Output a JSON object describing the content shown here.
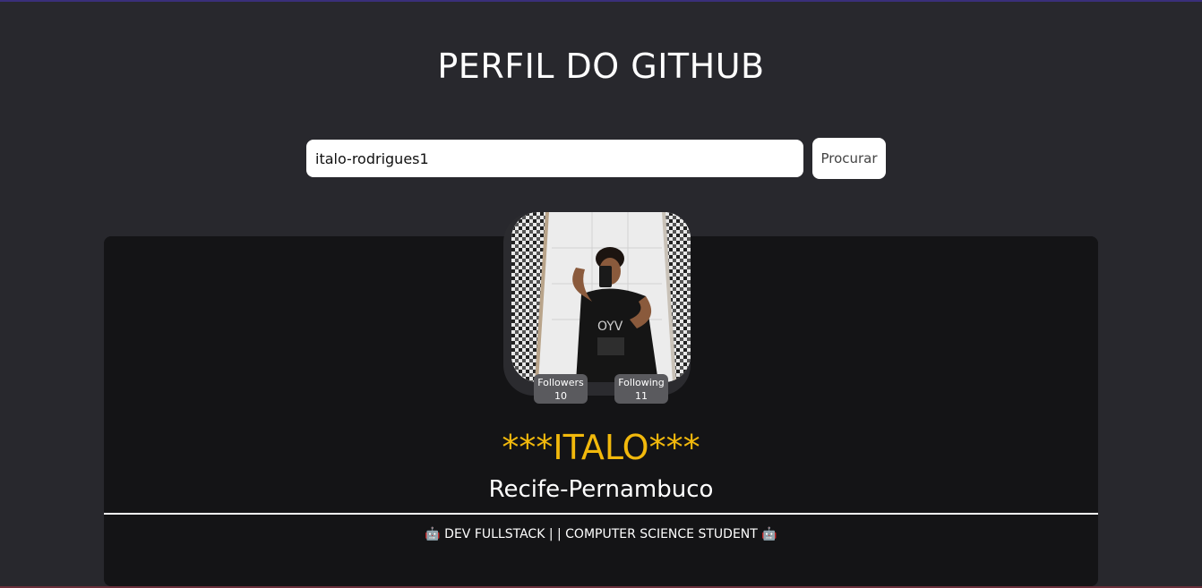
{
  "header": {
    "title": "PERFIL DO GITHUB"
  },
  "search": {
    "value": "italo-rodrigues1",
    "button_label": "Procurar"
  },
  "profile": {
    "avatar_icon": "user-photo",
    "followers_label": "Followers",
    "followers_count": "10",
    "following_label": "Following",
    "following_count": "11",
    "name": "***ITALO***",
    "location": "Recife-Pernambuco",
    "bio": "🤖 DEV FULLSTACK | | COMPUTER SCIENCE STUDENT 🤖"
  },
  "colors": {
    "background": "#28282d",
    "card": "#141416",
    "name": "#f2b90c",
    "badge": "#5a5a5e"
  }
}
